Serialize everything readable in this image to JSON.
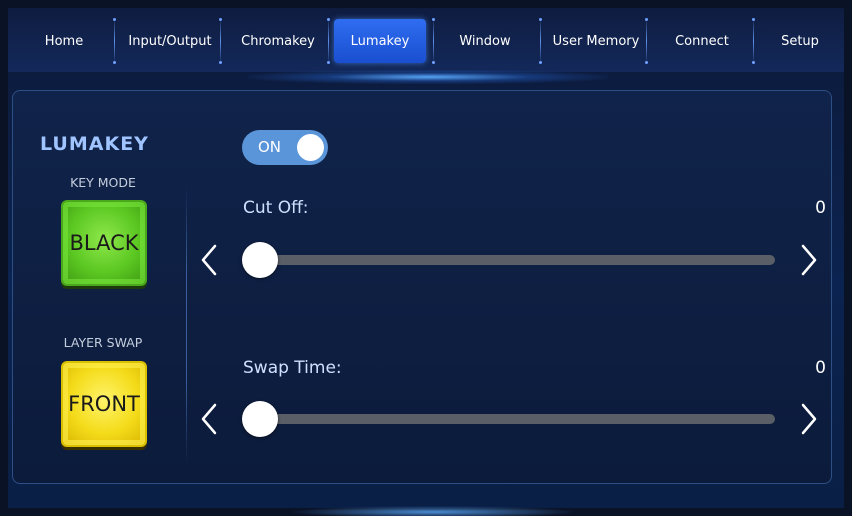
{
  "nav": {
    "tabs": [
      {
        "label": "Home"
      },
      {
        "label": "Input/Output"
      },
      {
        "label": "Chromakey"
      },
      {
        "label": "Lumakey"
      },
      {
        "label": "Window"
      },
      {
        "label": "User Memory"
      },
      {
        "label": "Connect"
      },
      {
        "label": "Setup"
      }
    ],
    "active_tab": "Lumakey"
  },
  "lumakey": {
    "logo": "LUMAKEY",
    "toggle_label": "ON",
    "toggle_state": "on",
    "key_mode_label": "KEY MODE",
    "key_mode_value": "BLACK",
    "layer_swap_label": "LAYER SWAP",
    "layer_swap_value": "FRONT",
    "cut_off_label": "Cut Off:",
    "cut_off_value": "0",
    "swap_time_label": "Swap Time:",
    "swap_time_value": "0"
  },
  "colors": {
    "active_tab": "#2f6df0",
    "key_mode_button": "#5cc822",
    "layer_swap_button": "#f4dc1a",
    "toggle_on": "#5b95d9"
  },
  "icons": {
    "decrease": "chevron-left-icon",
    "increase": "chevron-right-icon"
  }
}
